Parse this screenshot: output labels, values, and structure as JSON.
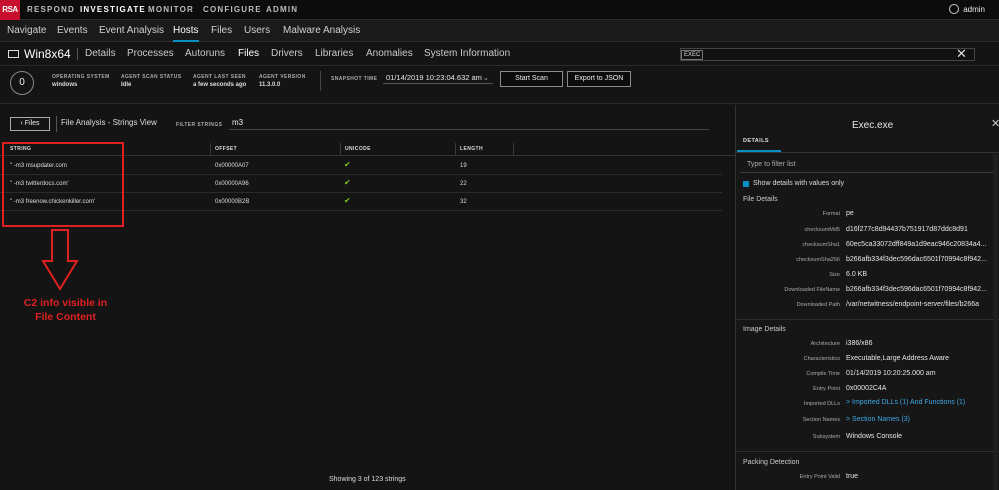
{
  "topbar": {
    "logo": "RSA",
    "nav": [
      "RESPOND",
      "INVESTIGATE",
      "MONITOR",
      "CONFIGURE",
      "ADMIN"
    ],
    "active": "INVESTIGATE",
    "user": "admin"
  },
  "nav2": {
    "items": [
      "Navigate",
      "Events",
      "Event Analysis",
      "Hosts",
      "Files",
      "Users",
      "Malware Analysis"
    ],
    "active": "Hosts"
  },
  "host": {
    "name": "Win8x64",
    "tabs": [
      "Details",
      "Processes",
      "Autoruns",
      "Files",
      "Drivers",
      "Libraries",
      "Anomalies",
      "System Information"
    ],
    "active_tab": "Files",
    "search_badge": "EXEC",
    "close": "✕"
  },
  "info": {
    "score": "0",
    "os_label": "OPERATING SYSTEM",
    "os_value": "windows",
    "agent_status_label": "AGENT SCAN STATUS",
    "agent_status_value": "Idle",
    "last_seen_label": "AGENT LAST SEEN",
    "last_seen_value": "a few seconds ago",
    "version_label": "AGENT VERSION",
    "version_value": "11.3.0.0",
    "snapshot_label": "SNAPSHOT TIME",
    "snapshot_value": "01/14/2019 10:23:04.632 am",
    "start_scan": "Start Scan",
    "export_json": "Export to JSON"
  },
  "file_analysis": {
    "back": "Files",
    "title": "File Analysis - Strings View",
    "filter_label": "FILTER STRINGS",
    "filter_value": "m3",
    "columns": [
      "STRING",
      "OFFSET",
      "UNICODE",
      "LENGTH"
    ],
    "rows": [
      {
        "string": "\" -m3 msupdater.com",
        "offset": "0x00000A07",
        "unicode": "✔",
        "length": "19"
      },
      {
        "string": "\" -m3 twitterdocs.com'",
        "offset": "0x00000A96",
        "unicode": "✔",
        "length": "22"
      },
      {
        "string": "\" -m3 freenow.chickenkiller.com'",
        "offset": "0x00000B2B",
        "unicode": "✔",
        "length": "32"
      }
    ],
    "annotation": "C2 info visible in File Content",
    "footer": "Showing 3 of 123 strings"
  },
  "details": {
    "title": "Exec.exe",
    "tab": "DETAILS",
    "filter_placeholder": "Type to filter list",
    "checkbox_label": "Show details with values only",
    "file_details_title": "File Details",
    "file_details": [
      {
        "k": "Format",
        "v": "pe"
      },
      {
        "k": "checksumMd5",
        "v": "d16f277c8d94437b751917d87ddc8d91"
      },
      {
        "k": "checksumSha1",
        "v": "60ec5ca33072dff849a1d9eac946c20834a4..."
      },
      {
        "k": "checksumSha256",
        "v": "b266afb334f3dec596dac6501f70994c8f942..."
      },
      {
        "k": "Size",
        "v": "6.0 KB"
      },
      {
        "k": "Downloaded FileName",
        "v": "b266afb334f3dec596dac6501f70994c8f942..."
      },
      {
        "k": "Downloaded Path",
        "v": "/var/netwitness/endpoint-server/files/b266a"
      }
    ],
    "image_details_title": "Image Details",
    "image_details": [
      {
        "k": "Architecture",
        "v": "i386/x86",
        "link": false
      },
      {
        "k": "Characteristics",
        "v": "Executable,Large Address Aware",
        "link": false
      },
      {
        "k": "Compile Time",
        "v": "01/14/2019 10:20:25.000 am",
        "link": false
      },
      {
        "k": "Entry Point",
        "v": "0x00002C4A",
        "link": false
      },
      {
        "k": "Imported DLLs",
        "v": "> Imported DLLs (1) And Functions (1)",
        "link": true
      },
      {
        "k": "Section Names",
        "v": "> Section Names (3)",
        "link": true
      },
      {
        "k": "Subsystem",
        "v": "Windows Console",
        "link": false
      }
    ],
    "packing_title": "Packing Detection",
    "packing": [
      {
        "k": "Entry Point Valid",
        "v": "true"
      }
    ]
  }
}
